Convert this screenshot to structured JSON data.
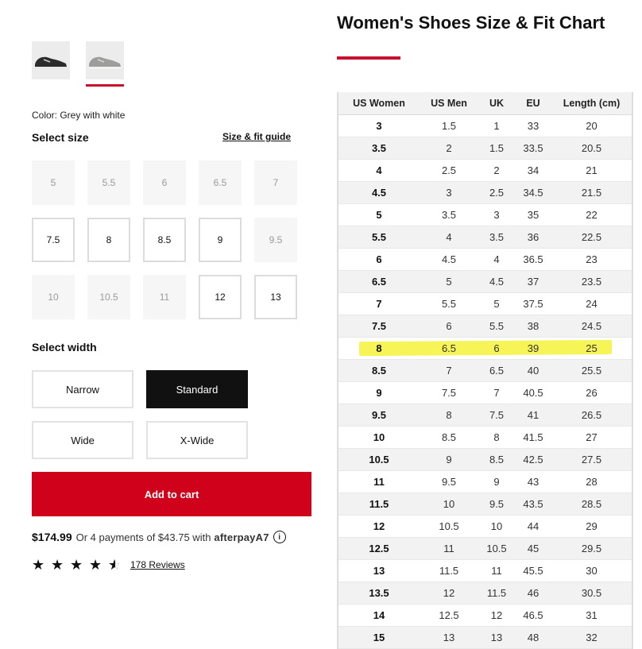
{
  "product": {
    "thumbnails": [
      {
        "name": "black-shoe-thumbnail",
        "color": "#2a2a2a"
      },
      {
        "name": "grey-shoe-thumbnail",
        "color": "#9a9a9a"
      }
    ],
    "color_label": "Color: Grey with white",
    "select_size_label": "Select size",
    "size_guide_label": "Size & fit guide",
    "sizes": [
      {
        "label": "5",
        "available": false
      },
      {
        "label": "5.5",
        "available": false
      },
      {
        "label": "6",
        "available": false
      },
      {
        "label": "6.5",
        "available": false
      },
      {
        "label": "7",
        "available": false
      },
      {
        "label": "7.5",
        "available": true
      },
      {
        "label": "8",
        "available": true
      },
      {
        "label": "8.5",
        "available": true
      },
      {
        "label": "9",
        "available": true
      },
      {
        "label": "9.5",
        "available": false
      },
      {
        "label": "10",
        "available": false
      },
      {
        "label": "10.5",
        "available": false
      },
      {
        "label": "11",
        "available": false
      },
      {
        "label": "12",
        "available": true
      },
      {
        "label": "13",
        "available": true
      }
    ],
    "select_width_label": "Select width",
    "widths": [
      {
        "label": "Narrow",
        "selected": false
      },
      {
        "label": "Standard",
        "selected": true
      },
      {
        "label": "Wide",
        "selected": false
      },
      {
        "label": "X-Wide",
        "selected": false
      }
    ],
    "add_to_cart_label": "Add to cart",
    "price": "$174.99",
    "installments_text": "Or 4 payments of $43.75 with",
    "afterpay_label": "afterpay",
    "afterpay_mark": "A7",
    "info_label": "i",
    "rating": 4.5,
    "reviews_label": "178 Reviews"
  },
  "chart": {
    "title": "Women's Shoes Size & Fit Chart",
    "headers": [
      "US Women",
      "US Men",
      "UK",
      "EU",
      "Length (cm)"
    ],
    "highlighted_row": "8.5",
    "rows": [
      [
        "3",
        "1.5",
        "1",
        "33",
        "20"
      ],
      [
        "3.5",
        "2",
        "1.5",
        "33.5",
        "20.5"
      ],
      [
        "4",
        "2.5",
        "2",
        "34",
        "21"
      ],
      [
        "4.5",
        "3",
        "2.5",
        "34.5",
        "21.5"
      ],
      [
        "5",
        "3.5",
        "3",
        "35",
        "22"
      ],
      [
        "5.5",
        "4",
        "3.5",
        "36",
        "22.5"
      ],
      [
        "6",
        "4.5",
        "4",
        "36.5",
        "23"
      ],
      [
        "6.5",
        "5",
        "4.5",
        "37",
        "23.5"
      ],
      [
        "7",
        "5.5",
        "5",
        "37.5",
        "24"
      ],
      [
        "7.5",
        "6",
        "5.5",
        "38",
        "24.5"
      ],
      [
        "8",
        "6.5",
        "6",
        "39",
        "25"
      ],
      [
        "8.5",
        "7",
        "6.5",
        "40",
        "25.5"
      ],
      [
        "9",
        "7.5",
        "7",
        "40.5",
        "26"
      ],
      [
        "9.5",
        "8",
        "7.5",
        "41",
        "26.5"
      ],
      [
        "10",
        "8.5",
        "8",
        "41.5",
        "27"
      ],
      [
        "10.5",
        "9",
        "8.5",
        "42.5",
        "27.5"
      ],
      [
        "11",
        "9.5",
        "9",
        "43",
        "28"
      ],
      [
        "11.5",
        "10",
        "9.5",
        "43.5",
        "28.5"
      ],
      [
        "12",
        "10.5",
        "10",
        "44",
        "29"
      ],
      [
        "12.5",
        "11",
        "10.5",
        "45",
        "29.5"
      ],
      [
        "13",
        "11.5",
        "11",
        "45.5",
        "30"
      ],
      [
        "13.5",
        "12",
        "11.5",
        "46",
        "30.5"
      ],
      [
        "14",
        "12.5",
        "12",
        "46.5",
        "31"
      ],
      [
        "15",
        "13",
        "13",
        "48",
        "32"
      ]
    ]
  },
  "colors": {
    "brand_red": "#d0021b",
    "highlight_yellow": "#f6f23a"
  }
}
